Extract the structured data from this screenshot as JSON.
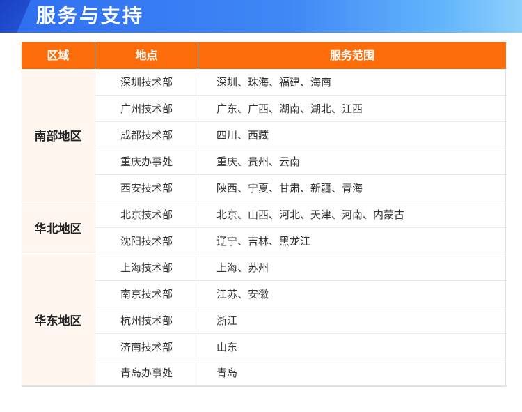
{
  "banner": {
    "title": "服务与支持"
  },
  "table": {
    "headers": {
      "region": "区域",
      "location": "地点",
      "service": "服务范围"
    },
    "regions": [
      {
        "name": "南部地区",
        "rows": [
          {
            "location": "深圳技术部",
            "service": "深圳、珠海、福建、海南"
          },
          {
            "location": "广州技术部",
            "service": "广东、广西、湖南、湖北、江西"
          },
          {
            "location": "成都技术部",
            "service": "四川、西藏"
          },
          {
            "location": "重庆办事处",
            "service": "重庆、贵州、云南"
          },
          {
            "location": "西安技术部",
            "service": "陕西、宁夏、甘肃、新疆、青海"
          }
        ]
      },
      {
        "name": "华北地区",
        "rows": [
          {
            "location": "北京技术部",
            "service": "北京、山西、河北、天津、河南、内蒙古"
          },
          {
            "location": "沈阳技术部",
            "service": "辽宁、吉林、黑龙江"
          }
        ]
      },
      {
        "name": "华东地区",
        "rows": [
          {
            "location": "上海技术部",
            "service": "上海、苏州"
          },
          {
            "location": "南京技术部",
            "service": "江苏、安徽"
          },
          {
            "location": "杭州技术部",
            "service": "浙江"
          },
          {
            "location": "济南技术部",
            "service": "山东"
          },
          {
            "location": "青岛办事处",
            "service": "青岛"
          }
        ]
      }
    ]
  },
  "colors": {
    "header": "#fe6d0c",
    "banner": "#3f87f6",
    "region_bg": "#fff6ef"
  }
}
